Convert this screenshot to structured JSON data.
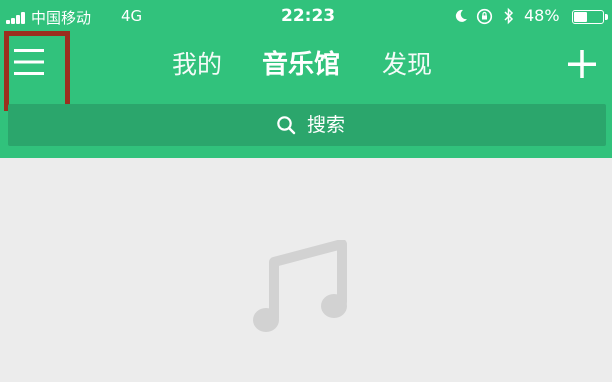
{
  "status_bar": {
    "carrier": "中国移动",
    "network": "4G",
    "time": "22:23",
    "battery_percent": "48%",
    "battery_level": 0.48,
    "icons": [
      "moon-icon",
      "orientation-lock-icon",
      "bluetooth-icon"
    ]
  },
  "header": {
    "menu_icon": "hamburger-menu-icon",
    "tabs": [
      {
        "label": "我的"
      },
      {
        "label": "音乐馆"
      },
      {
        "label": "发现"
      }
    ],
    "active_tab": "音乐馆",
    "add_icon": "plus-icon"
  },
  "search": {
    "placeholder": "搜索",
    "icon": "search-icon"
  },
  "content": {
    "placeholder_icon": "music-note-icon"
  },
  "colors": {
    "header_green": "#31c27c",
    "search_green": "#2ba66c",
    "content_gray": "#ececec",
    "placeholder_icon_gray": "#d2d2d2",
    "highlight_box": "#9b2f1e"
  }
}
